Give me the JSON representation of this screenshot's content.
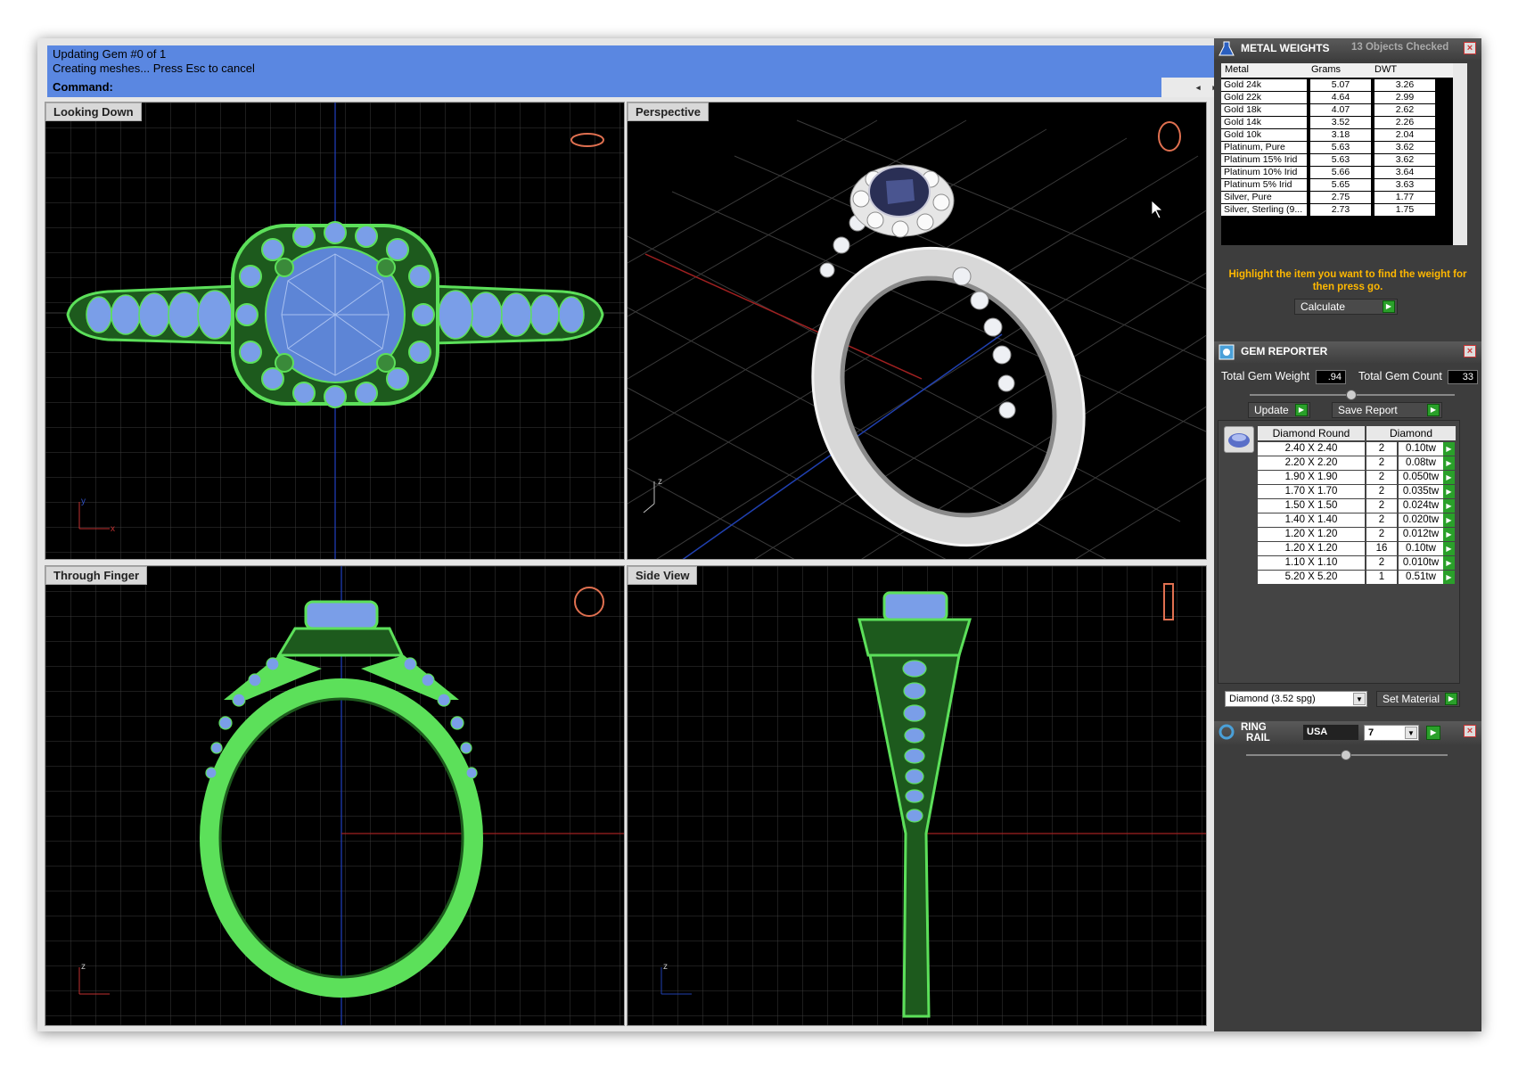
{
  "command": {
    "history": [
      "Updating Gem #0 of 1",
      "Creating meshes... Press Esc to cancel"
    ],
    "prompt": "Command:"
  },
  "viewports": {
    "looking_down": "Looking Down",
    "perspective": "Perspective",
    "through_finger": "Through Finger",
    "side_view": "Side View"
  },
  "metal_weights": {
    "title": "METAL WEIGHTS",
    "status": "13 Objects Checked",
    "columns": [
      "Metal",
      "Grams",
      "DWT"
    ],
    "rows": [
      [
        "Gold 24k",
        "5.07",
        "3.26"
      ],
      [
        "Gold 22k",
        "4.64",
        "2.99"
      ],
      [
        "Gold 18k",
        "4.07",
        "2.62"
      ],
      [
        "Gold 14k",
        "3.52",
        "2.26"
      ],
      [
        "Gold 10k",
        "3.18",
        "2.04"
      ],
      [
        "Platinum, Pure",
        "5.63",
        "3.62"
      ],
      [
        "Platinum 15% Irid",
        "5.63",
        "3.62"
      ],
      [
        "Platinum 10% Irid",
        "5.66",
        "3.64"
      ],
      [
        "Platinum 5% Irid",
        "5.65",
        "3.63"
      ],
      [
        "Silver, Pure",
        "2.75",
        "1.77"
      ],
      [
        "Silver, Sterling (9...",
        "2.73",
        "1.75"
      ]
    ],
    "hint": "Highlight the item you want to find the weight for then press go.",
    "calculate_label": "Calculate"
  },
  "gem_reporter": {
    "title": "GEM REPORTER",
    "total_weight_label": "Total Gem Weight",
    "total_weight": ".94",
    "total_count_label": "Total Gem Count",
    "total_count": "33",
    "update_label": "Update",
    "save_label": "Save Report",
    "col_shape": "Diamond Round",
    "col_material": "Diamond",
    "rows": [
      [
        "2.40 X 2.40",
        "2",
        "0.10tw"
      ],
      [
        "2.20 X 2.20",
        "2",
        "0.08tw"
      ],
      [
        "1.90 X 1.90",
        "2",
        "0.050tw"
      ],
      [
        "1.70 X 1.70",
        "2",
        "0.035tw"
      ],
      [
        "1.50 X 1.50",
        "2",
        "0.024tw"
      ],
      [
        "1.40 X 1.40",
        "2",
        "0.020tw"
      ],
      [
        "1.20 X 1.20",
        "2",
        "0.012tw"
      ],
      [
        "1.20 X 1.20",
        "16",
        "0.10tw"
      ],
      [
        "1.10 X 1.10",
        "2",
        "0.010tw"
      ],
      [
        "5.20 X 5.20",
        "1",
        "0.51tw"
      ]
    ],
    "material_select": "Diamond    (3.52 spg)",
    "set_material_label": "Set Material"
  },
  "ring_rail": {
    "title_1": "RING",
    "title_2": "RAIL",
    "country": "USA",
    "size": "7"
  },
  "colors": {
    "wire_green": "#5ce05a",
    "gem_blue": "#7a9ee8",
    "highlight_orange": "#ffb800",
    "command_blue": "#5a87e1"
  }
}
